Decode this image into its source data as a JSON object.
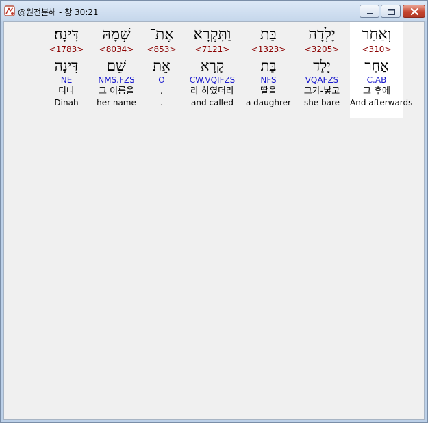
{
  "window": {
    "title": "@원전분해 - 창 30:21"
  },
  "icons": {
    "app": "app-icon",
    "minimize": "minimize-icon",
    "maximize": "maximize-icon",
    "close": "close-icon"
  },
  "colors": {
    "strong_number": "#8b0000",
    "parsing_code": "#1a1acd",
    "highlight_background": "#ffffff",
    "close_button": "#c4452f"
  },
  "words": [
    {
      "hebrew": "וְאַחַר",
      "strong": "<310>",
      "lemma": "אַחַר",
      "parsing": "C.AB",
      "korean": "그 후에",
      "english": "And afterwards",
      "selected": true
    },
    {
      "hebrew": "יָלְדָה",
      "strong": "<3205>",
      "lemma": "יָלַד",
      "parsing": "VQAFZS",
      "korean": "그가-낳고",
      "english": "she bare"
    },
    {
      "hebrew": "בַּת",
      "strong": "<1323>",
      "lemma": "בַּת",
      "parsing": "NFS",
      "korean": "딸을",
      "english": "a daughrer"
    },
    {
      "hebrew": "וַתִּקְרָא",
      "strong": "<7121>",
      "lemma": "קָרָא",
      "parsing": "CW.VQIFZS",
      "korean": "라 하였더라",
      "english": "and called"
    },
    {
      "hebrew": "אֶת־",
      "strong": "<853>",
      "lemma": "אֵת",
      "parsing": "O",
      "korean": ".",
      "english": "."
    },
    {
      "hebrew": "שְׁמָהּ",
      "strong": "<8034>",
      "lemma": "שֵׁם",
      "parsing": "NMS.FZS",
      "korean": "그 이름을",
      "english": "her name"
    },
    {
      "hebrew": "דִּינָה׃",
      "strong": "<1783>",
      "lemma": "דִּינָה",
      "parsing": "NE",
      "korean": "디나",
      "english": "Dinah"
    }
  ]
}
